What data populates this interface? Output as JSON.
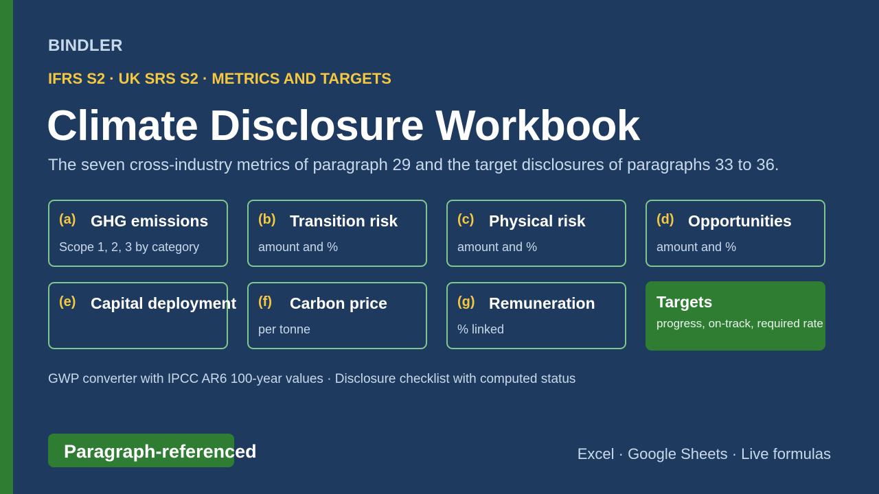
{
  "brand": "BINDLER",
  "kicker": "IFRS S2 · UK SRS S2 · METRICS AND TARGETS",
  "title": "Climate Disclosure Workbook",
  "subtitle": "The seven cross-industry metrics of paragraph 29 and the target disclosures of paragraphs 33 to 36.",
  "cards": [
    {
      "letter": "(a)",
      "name": "GHG emissions",
      "desc": "Scope 1, 2, 3 by category"
    },
    {
      "letter": "(b)",
      "name": "Transition risk",
      "desc": "amount and %"
    },
    {
      "letter": "(c)",
      "name": "Physical risk",
      "desc": "amount and %"
    },
    {
      "letter": "(d)",
      "name": "Opportunities",
      "desc": "amount and %"
    },
    {
      "letter": "(e)",
      "name": "Capital deployment",
      "desc": ""
    },
    {
      "letter": "(f)",
      "name": "Carbon price",
      "desc": "per tonne"
    },
    {
      "letter": "(g)",
      "name": "Remuneration",
      "desc": "% linked"
    },
    {
      "letter": "",
      "name": "Targets",
      "desc": "progress, on-track, required rate"
    }
  ],
  "note": "GWP converter with IPCC AR6 100-year values · Disclosure checklist with computed status",
  "badge": "Paragraph-referenced",
  "platforms": "Excel · Google Sheets · Live formulas",
  "colors": {
    "background": "#1f3a5f",
    "accent_green": "#2e7d32",
    "card_border": "#7dc98b",
    "kicker_yellow": "#f5c842",
    "muted_text": "#c9d9ec"
  }
}
